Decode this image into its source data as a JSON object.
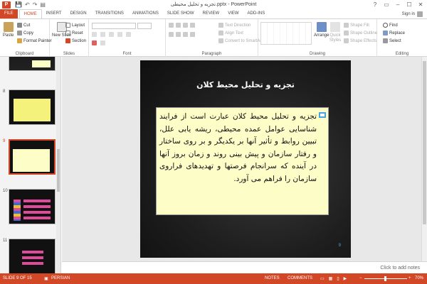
{
  "titlebar": {
    "app_letter": "P",
    "title": "تجزیه و تحلیل محیطی.pptx - PowerPoint",
    "qat": [
      "💾",
      "↶",
      "↷",
      "▤"
    ],
    "controls": [
      "?",
      "▭",
      "–",
      "☐",
      "✕"
    ]
  },
  "tabs": [
    "FILE",
    "HOME",
    "INSERT",
    "DESIGN",
    "TRANSITIONS",
    "ANIMATIONS",
    "SLIDE SHOW",
    "REVIEW",
    "VIEW",
    "ADD-INS"
  ],
  "active_tab": "HOME",
  "signin": "Sign in",
  "ribbon": {
    "clipboard": {
      "label": "Clipboard",
      "paste": "Paste",
      "cut": "Cut",
      "copy": "Copy",
      "format_painter": "Format Painter"
    },
    "slides": {
      "label": "Slides",
      "new_slide": "New Slide",
      "layout": "Layout",
      "reset": "Reset",
      "section": "Section"
    },
    "font": {
      "label": "Font"
    },
    "paragraph": {
      "label": "Paragraph",
      "text_direction": "Text Direction",
      "align_text": "Align Text",
      "convert_smartart": "Convert to SmartArt"
    },
    "drawing": {
      "label": "Drawing",
      "arrange": "Arrange",
      "quick_styles": "Quick Styles",
      "shape_fill": "Shape Fill",
      "shape_outline": "Shape Outline",
      "shape_effects": "Shape Effects"
    },
    "editing": {
      "label": "Editing",
      "find": "Find",
      "replace": "Replace",
      "select": "Select"
    }
  },
  "thumbnails": [
    {
      "num": "",
      "selected": false
    },
    {
      "num": "8",
      "selected": false
    },
    {
      "num": "9",
      "selected": true
    },
    {
      "num": "10",
      "selected": false
    },
    {
      "num": "11",
      "selected": false
    }
  ],
  "slide": {
    "title": "تجزیه و تحلیل محیط کلان",
    "body": "تجزیه و تحلیل محیط کلان عبارت است از فرایند شناسایی عوامل عمده محیطی، ریشه یابی علل، تبیین روابط و تأثیر آنها بر یکدیگر و بر روی ساختار و رفتار سازمان و پیش بینی روند و زمان بروز آنها در آینده که سرانجام فرصتها و تهدیدهای فراروی سازمان را فراهم می آورد.",
    "number": "9"
  },
  "notes_hint": "Click to add notes",
  "status": {
    "slide_of": "SLIDE 9 OF 15",
    "language": "PERSIAN",
    "notes": "NOTES",
    "comments": "COMMENTS",
    "zoom": "70%"
  },
  "colors": {
    "accent": "#d24726",
    "textbox": "#fdfdc8"
  }
}
